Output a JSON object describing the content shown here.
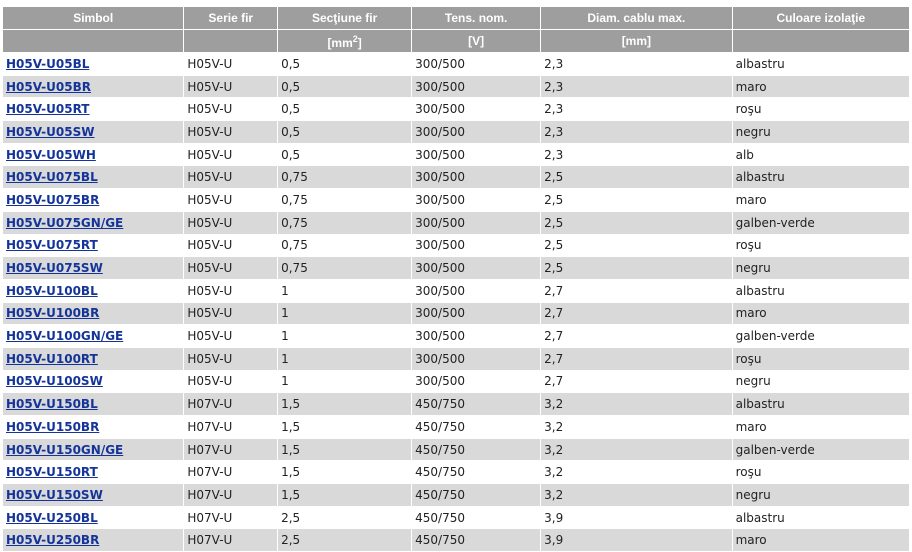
{
  "table": {
    "headers": {
      "symbol": "Simbol",
      "series": "Serie fir",
      "section": "Secţiune fir",
      "voltage": "Tens. nom.",
      "diameter": "Diam. cablu max.",
      "color": "Culoare izolaţie"
    },
    "units": {
      "symbol": "",
      "series": "",
      "section_prefix": "[mm",
      "section_sup": "2",
      "section_suffix": "]",
      "voltage": "[V]",
      "diameter": "[mm]",
      "color": ""
    },
    "rows": [
      {
        "symbol": "H05V-U05BL",
        "series": "H05V-U",
        "section": "0,5",
        "voltage": "300/500",
        "diameter": "2,3",
        "color": "albastru"
      },
      {
        "symbol": "H05V-U05BR",
        "series": "H05V-U",
        "section": "0,5",
        "voltage": "300/500",
        "diameter": "2,3",
        "color": "maro"
      },
      {
        "symbol": "H05V-U05RT",
        "series": "H05V-U",
        "section": "0,5",
        "voltage": "300/500",
        "diameter": "2,3",
        "color": "roşu"
      },
      {
        "symbol": "H05V-U05SW",
        "series": "H05V-U",
        "section": "0,5",
        "voltage": "300/500",
        "diameter": "2,3",
        "color": "negru"
      },
      {
        "symbol": "H05V-U05WH",
        "series": "H05V-U",
        "section": "0,5",
        "voltage": "300/500",
        "diameter": "2,3",
        "color": "alb"
      },
      {
        "symbol": "H05V-U075BL",
        "series": "H05V-U",
        "section": "0,75",
        "voltage": "300/500",
        "diameter": "2,5",
        "color": "albastru"
      },
      {
        "symbol": "H05V-U075BR",
        "series": "H05V-U",
        "section": "0,75",
        "voltage": "300/500",
        "diameter": "2,5",
        "color": "maro"
      },
      {
        "symbol": "H05V-U075GN/GE",
        "series": "H05V-U",
        "section": "0,75",
        "voltage": "300/500",
        "diameter": "2,5",
        "color": "galben-verde"
      },
      {
        "symbol": "H05V-U075RT",
        "series": "H05V-U",
        "section": "0,75",
        "voltage": "300/500",
        "diameter": "2,5",
        "color": "roşu"
      },
      {
        "symbol": "H05V-U075SW",
        "series": "H05V-U",
        "section": "0,75",
        "voltage": "300/500",
        "diameter": "2,5",
        "color": "negru"
      },
      {
        "symbol": "H05V-U100BL",
        "series": "H05V-U",
        "section": "1",
        "voltage": "300/500",
        "diameter": "2,7",
        "color": "albastru"
      },
      {
        "symbol": "H05V-U100BR",
        "series": "H05V-U",
        "section": "1",
        "voltage": "300/500",
        "diameter": "2,7",
        "color": "maro"
      },
      {
        "symbol": "H05V-U100GN/GE",
        "series": "H05V-U",
        "section": "1",
        "voltage": "300/500",
        "diameter": "2,7",
        "color": "galben-verde"
      },
      {
        "symbol": "H05V-U100RT",
        "series": "H05V-U",
        "section": "1",
        "voltage": "300/500",
        "diameter": "2,7",
        "color": "roşu"
      },
      {
        "symbol": "H05V-U100SW",
        "series": "H05V-U",
        "section": "1",
        "voltage": "300/500",
        "diameter": "2,7",
        "color": "negru"
      },
      {
        "symbol": "H05V-U150BL",
        "series": "H07V-U",
        "section": "1,5",
        "voltage": "450/750",
        "diameter": "3,2",
        "color": "albastru"
      },
      {
        "symbol": "H05V-U150BR",
        "series": "H07V-U",
        "section": "1,5",
        "voltage": "450/750",
        "diameter": "3,2",
        "color": "maro"
      },
      {
        "symbol": "H05V-U150GN/GE",
        "series": "H07V-U",
        "section": "1,5",
        "voltage": "450/750",
        "diameter": "3,2",
        "color": "galben-verde"
      },
      {
        "symbol": "H05V-U150RT",
        "series": "H07V-U",
        "section": "1,5",
        "voltage": "450/750",
        "diameter": "3,2",
        "color": "roşu"
      },
      {
        "symbol": "H05V-U150SW",
        "series": "H07V-U",
        "section": "1,5",
        "voltage": "450/750",
        "diameter": "3,2",
        "color": "negru"
      },
      {
        "symbol": "H05V-U250BL",
        "series": "H07V-U",
        "section": "2,5",
        "voltage": "450/750",
        "diameter": "3,9",
        "color": "albastru"
      },
      {
        "symbol": "H05V-U250BR",
        "series": "H07V-U",
        "section": "2,5",
        "voltage": "450/750",
        "diameter": "3,9",
        "color": "maro"
      }
    ]
  },
  "colors": {
    "header_bg": "#9e9e9e",
    "header_text": "#ffffff",
    "alt_row_bg": "#d9d9d9",
    "link": "#14349a"
  }
}
